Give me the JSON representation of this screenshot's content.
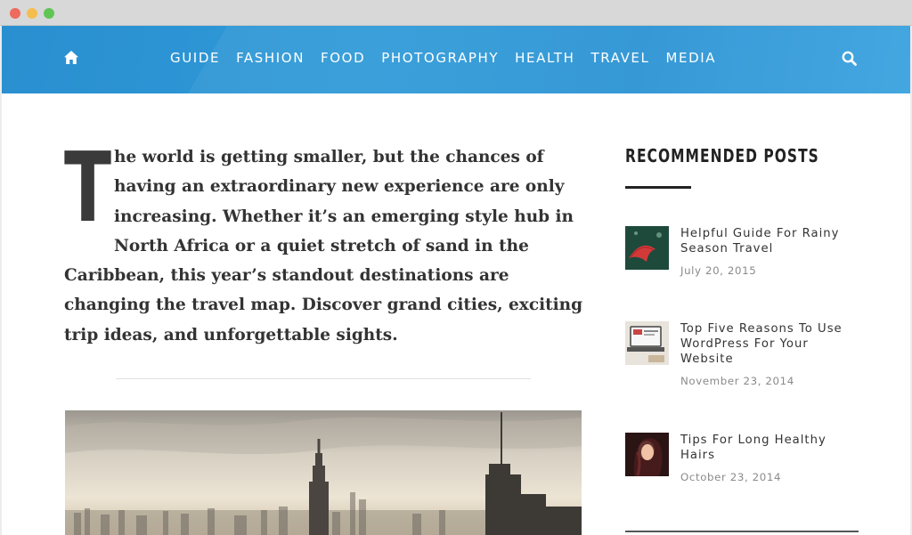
{
  "window": {
    "controls": [
      "close",
      "minimize",
      "maximize"
    ]
  },
  "nav": {
    "home_icon": "home-icon",
    "search_icon": "search-icon",
    "items": [
      "GUIDE",
      "FASHION",
      "FOOD",
      "PHOTOGRAPHY",
      "HEALTH",
      "TRAVEL",
      "MEDIA"
    ],
    "colors": {
      "bar": "#2a93d4",
      "text": "#ffffff"
    }
  },
  "article": {
    "dropcap": "T",
    "intro": "he world is getting smaller, but the chances of having an extraordinary new experience are only increasing. Whether it’s an emerging style hub in North Africa or a quiet stretch of sand in the Caribbean, this year’s standout destinations are changing the travel map. Discover grand cities, exciting trip ideas, and unforgettable sights."
  },
  "sidebar": {
    "title": "RECOMMENDED POSTS",
    "posts": [
      {
        "title": "Helpful Guide For Rainy Season Travel",
        "date": "July 20, 2015"
      },
      {
        "title": "Top Five Reasons To Use WordPress For Your Website",
        "date": "November 23, 2014"
      },
      {
        "title": "Tips For Long Healthy Hairs",
        "date": "October 23, 2014"
      }
    ]
  }
}
